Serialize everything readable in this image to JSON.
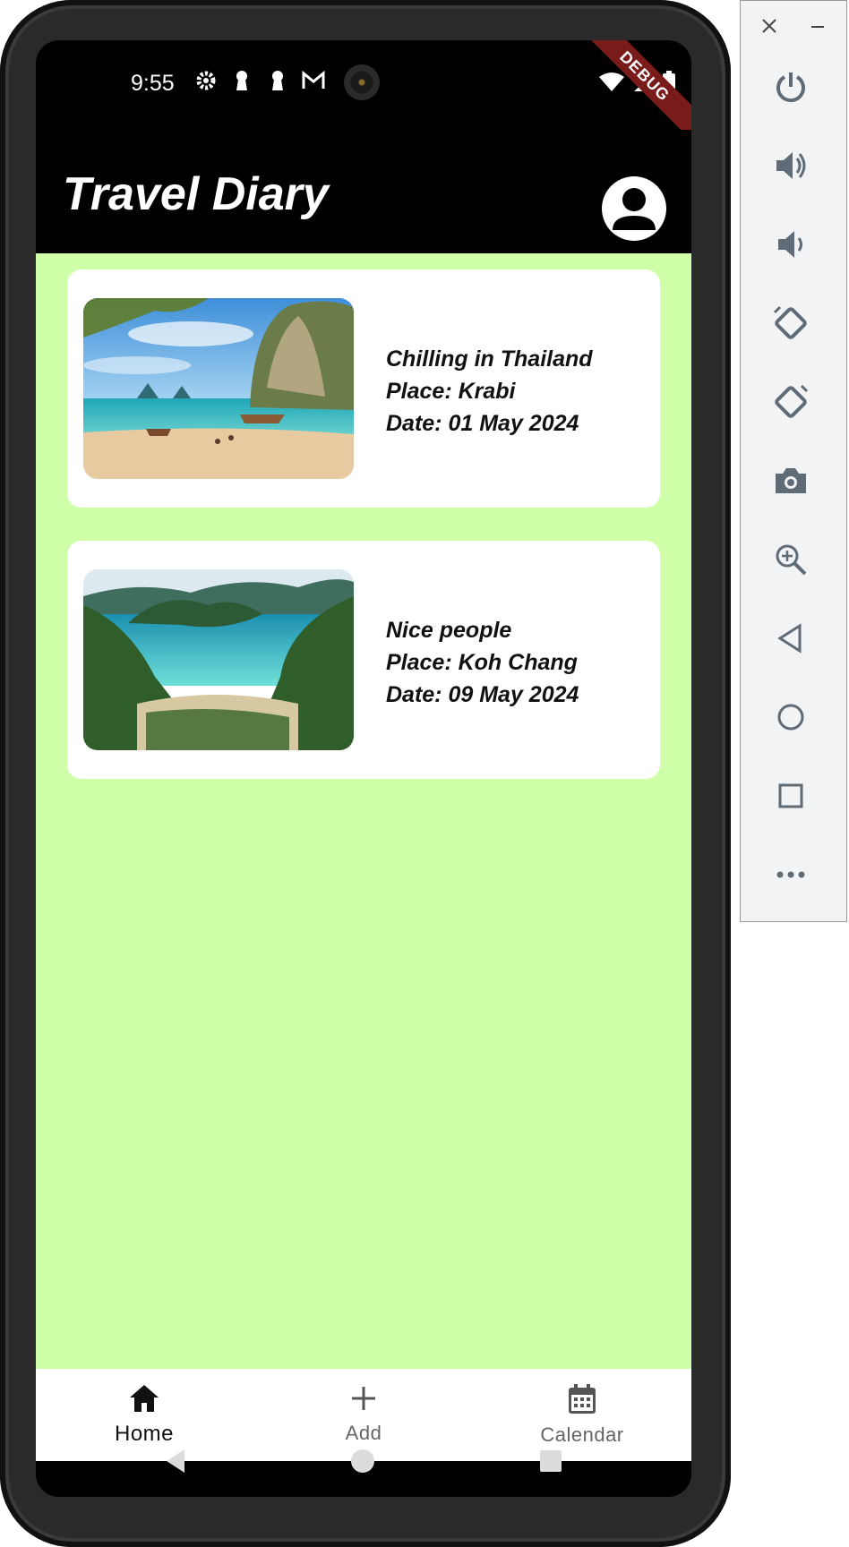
{
  "status_bar": {
    "time": "9:55",
    "debug_label": "DEBUG"
  },
  "app_bar": {
    "title": "Travel Diary"
  },
  "entries": [
    {
      "title": "Chilling in Thailand",
      "place": "Place: Krabi",
      "date": "Date: 01 May 2024",
      "image": "krabi-beach-photo"
    },
    {
      "title": "Nice people",
      "place": "Place: Koh Chang",
      "date": "Date: 09 May 2024",
      "image": "koh-chang-bay-photo"
    }
  ],
  "bottom_nav": {
    "items": [
      {
        "label": "Home",
        "icon": "home-icon",
        "active": true
      },
      {
        "label": "Add",
        "icon": "plus-icon",
        "active": false
      },
      {
        "label": "Calendar",
        "icon": "calendar-icon",
        "active": false
      }
    ]
  },
  "colors": {
    "content_background": "#cfffa9",
    "app_bar": "#000000",
    "card": "#ffffff",
    "debug_banner": "#7a1b1b"
  },
  "emulator_controls": [
    "close-icon",
    "minimize-icon",
    "power-icon",
    "volume-up-icon",
    "volume-down-icon",
    "rotate-left-icon",
    "rotate-right-icon",
    "screenshot-icon",
    "zoom-icon",
    "back-icon",
    "home-circle-icon",
    "overview-icon",
    "more-icon"
  ]
}
